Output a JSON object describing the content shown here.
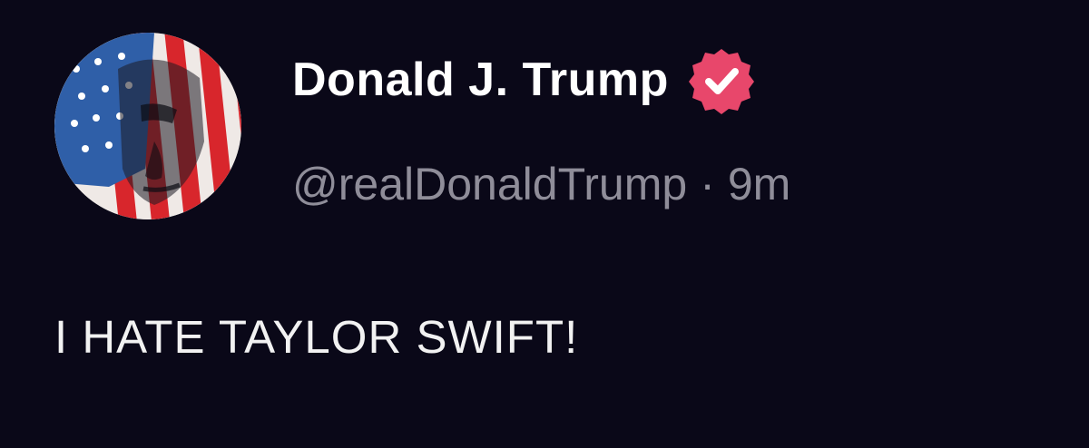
{
  "post": {
    "author": {
      "display_name": "Donald J. Trump",
      "handle": "@realDonaldTrump",
      "verified": true,
      "verified_icon": "verified-badge-icon",
      "avatar_icon": "flag-portrait-avatar"
    },
    "separator": "·",
    "timestamp": "9m",
    "text": "I HATE TAYLOR SWIFT!"
  },
  "colors": {
    "background": "#0a0818",
    "name_text": "#ffffff",
    "meta_text": "#8f8d99",
    "body_text": "#f2f2f2",
    "verified_badge": "#e8476b"
  }
}
